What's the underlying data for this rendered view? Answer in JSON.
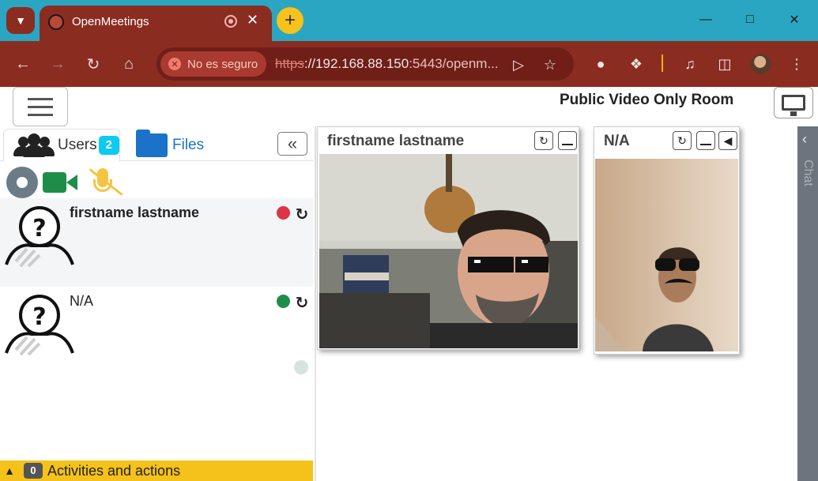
{
  "browser": {
    "tab_title": "OpenMeetings",
    "new_tab_icon": "plus-icon",
    "security_label": "No es seguro",
    "url_scheme": "https",
    "url_rest": "://192.168.88.150",
    "url_port_path": ":5443/openm..."
  },
  "app": {
    "room_title": "Public Video Only Room"
  },
  "sidebar": {
    "users_tab": "Users",
    "users_count": "2",
    "files_tab": "Files",
    "users": [
      {
        "name": "firstname lastname",
        "status_color": "#dc3545"
      },
      {
        "name": "N/A",
        "status_color": "#1f8d4a"
      }
    ],
    "activities_count": "0",
    "activities_label": "Activities and actions"
  },
  "videos": [
    {
      "title": "firstname lastname"
    },
    {
      "title": "N/A"
    }
  ],
  "chat": {
    "label": "Chat"
  },
  "colors": {
    "chrome_tab_strip": "#2aa6c2",
    "chrome_toolbar": "#8b2c21",
    "badge": "#0dcaf0",
    "files_blue": "#1a73c8",
    "activity_bar": "#f5c21b"
  }
}
